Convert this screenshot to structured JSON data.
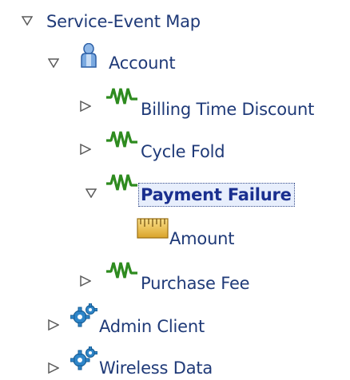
{
  "tree": {
    "root": {
      "label": "Service-Event Map",
      "expanded": true
    },
    "account": {
      "label": "Account",
      "icon": "person-icon",
      "expanded": true
    },
    "events": [
      {
        "label": "Billing Time Discount",
        "icon": "event-pulse-icon",
        "expanded": false
      },
      {
        "label": "Cycle Fold",
        "icon": "event-pulse-icon",
        "expanded": false
      },
      {
        "label": "Payment Failure",
        "icon": "event-pulse-icon",
        "expanded": true,
        "selected": true
      },
      {
        "label": "Purchase Fee",
        "icon": "event-pulse-icon",
        "expanded": false
      }
    ],
    "field": {
      "label": "Amount",
      "icon": "ruler-icon"
    },
    "services": [
      {
        "label": "Admin Client",
        "icon": "gear-icon",
        "expanded": false
      },
      {
        "label": "Wireless Data",
        "icon": "gear-icon",
        "expanded": false
      }
    ]
  },
  "colors": {
    "label_text": "#1f3a78",
    "selected_text": "#1a2f8f",
    "selection_bg": "#e7eefc",
    "event_icon": "#2e8b1f",
    "gear_icon": "#2f86c9",
    "ruler_icon": "#e2b23a"
  }
}
